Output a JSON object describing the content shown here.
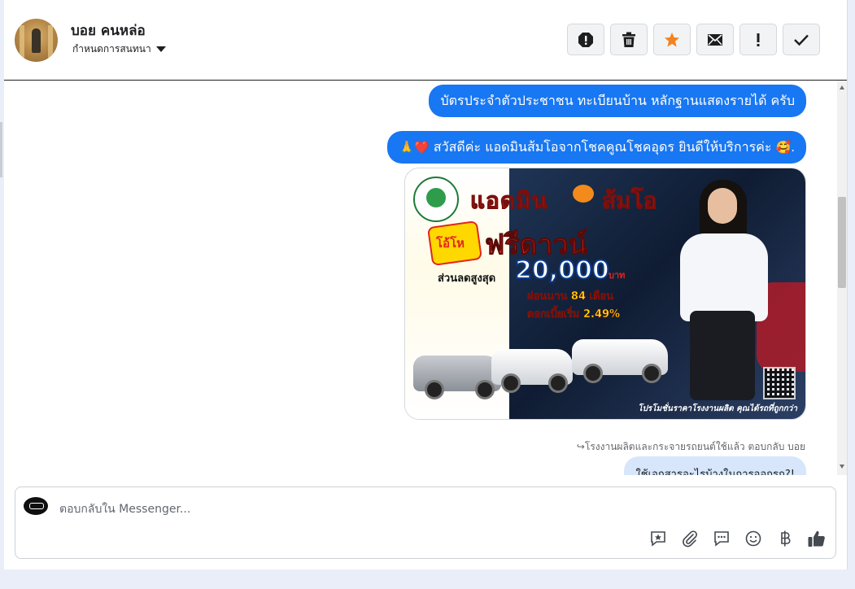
{
  "header": {
    "name": "บอย คนหล่อ",
    "assign_label": "กำหนดการสนทนา",
    "toolbar": [
      {
        "name": "spam-icon",
        "glyph": "!"
      },
      {
        "name": "trash-icon"
      },
      {
        "name": "star-icon"
      },
      {
        "name": "mail-icon"
      },
      {
        "name": "exclamation-icon",
        "glyph": "!"
      },
      {
        "name": "check-icon"
      }
    ]
  },
  "conversation": {
    "message_1": "บัตรประจำตัวประชาชน ทะเบียนบ้าน หลักฐานแสดงรายได้ ครับ",
    "message_2_pre": "🙏❤️",
    "message_2_text": " สวัสดีค่ะ แอดมินส้มโอจากโชคคูณโชคอุดร ยินดีให้บริการค่ะ ",
    "message_2_post": "🥰.",
    "promo": {
      "title_admin": "แอดมิน",
      "title_name": "ส้มโอ",
      "give": "โอ้โห",
      "free": "ฟรีดาวน์",
      "discount": "ส่วนลดสูงสุด",
      "amount": "20,000",
      "baht": "บาท",
      "months": "ผ่อนนาน 84 เดือน",
      "rate": "ดอกเบี้ยเริ่ม 2.49%",
      "bottom": "โปรโมชั่นราคาโรงงานผลิต คุณได้รถที่ถูกกว่า"
    },
    "reply_meta": "↪โรงงานผลิตและกระจายรถยนต์ใช้แล้ว ตอบกลับ บอย",
    "message_3": "ใช้เอกสารอะไรบ้างในการออกรถ?!"
  },
  "composer": {
    "placeholder": "ตอบกลับใน Messenger...",
    "tools": [
      "saved-reply-icon",
      "attach-icon",
      "chat-icon",
      "emoji-icon",
      "baht-icon",
      "like-icon"
    ]
  },
  "colors": {
    "accent": "#1877f2",
    "star": "#f5821f",
    "reply_bubble": "#d7e6fb"
  }
}
